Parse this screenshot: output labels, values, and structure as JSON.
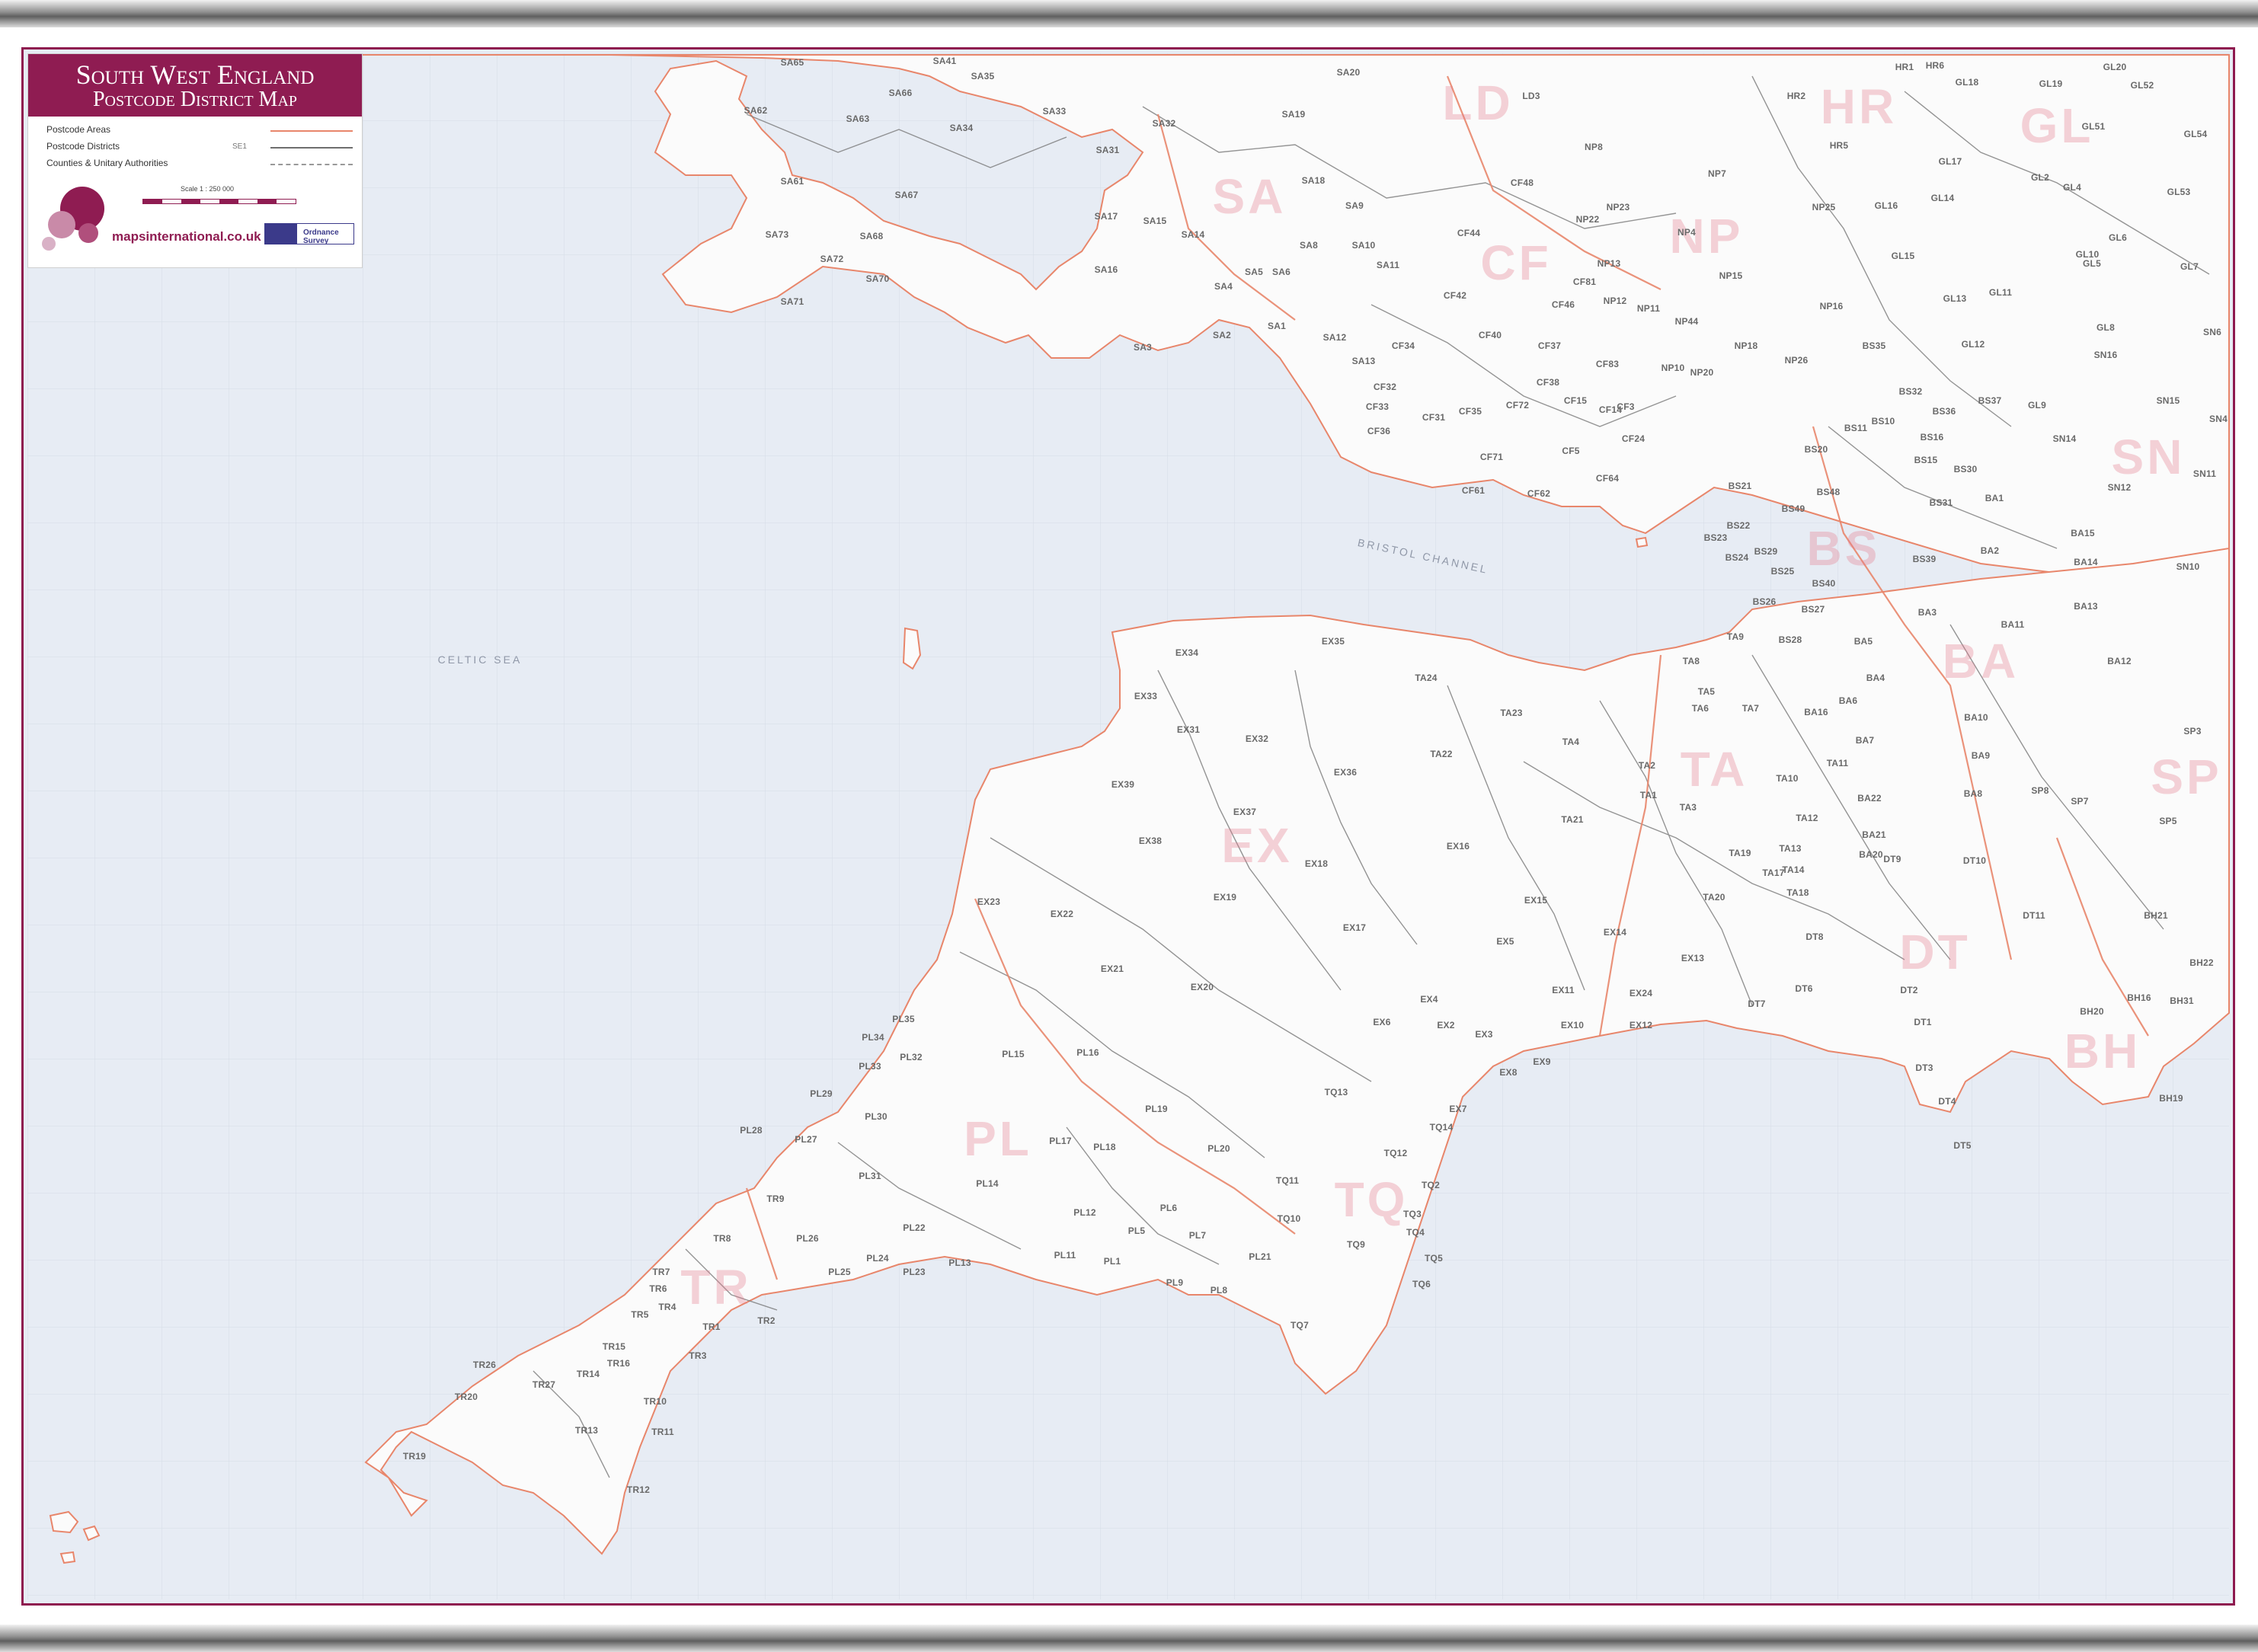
{
  "legend": {
    "title_line1": "South West England",
    "title_line2": "Postcode District Map",
    "items": [
      {
        "label": "Postcode Areas"
      },
      {
        "label": "Postcode Districts",
        "sample": "SE1"
      },
      {
        "label": "Counties & Unitary Authorities"
      }
    ],
    "scale": "Scale 1 : 250 000",
    "brand": "mapsinternational.co.uk",
    "os_badge": "Ordnance Survey"
  },
  "colors": {
    "frame": "#8f1c52",
    "sea": "#e7ecf4",
    "land": "#fbfbfb",
    "district_border": "#6e6e6e",
    "area_border": "#e8866b",
    "area_label": "#e4788c"
  },
  "sea_labels": [
    "CELTIC SEA",
    "BRISTOL CHANNEL"
  ],
  "area_labels": [
    "LD",
    "HR",
    "GL",
    "SA",
    "CF",
    "NP",
    "BS",
    "BA",
    "SN",
    "TA",
    "EX",
    "DT",
    "PL",
    "TQ",
    "TR",
    "BH",
    "SP"
  ],
  "districts": [
    "SA65",
    "SA41",
    "SA35",
    "SA20",
    "LD3",
    "HR1",
    "HR6",
    "GL20",
    "SA62",
    "SA66",
    "SA63",
    "SA33",
    "SA32",
    "SA19",
    "HR2",
    "GL18",
    "GL19",
    "GL52",
    "SA34",
    "NP8",
    "HR5",
    "GL51",
    "GL54",
    "SA31",
    "NP7",
    "GL17",
    "GL2",
    "GL4",
    "SA61",
    "SA67",
    "SA17",
    "SA15",
    "SA18",
    "CF48",
    "SA9",
    "NP22",
    "NP23",
    "NP25",
    "GL16",
    "GL14",
    "GL53",
    "SA14",
    "SA10",
    "CF44",
    "NP4",
    "GL6",
    "SA73",
    "SA68",
    "SA8",
    "SA11",
    "NP13",
    "SA72",
    "SA70",
    "SA16",
    "SA5",
    "SA6",
    "SA4",
    "CF81",
    "NP12",
    "NP15",
    "GL15",
    "GL10",
    "GL5",
    "GL7",
    "SA71",
    "SA2",
    "SA1",
    "SA12",
    "CF42",
    "CF46",
    "NP11",
    "NP44",
    "NP16",
    "GL13",
    "GL11",
    "SA3",
    "SA13",
    "CF34",
    "CF40",
    "CF37",
    "NP18",
    "GL8",
    "CF83",
    "NP10",
    "NP20",
    "NP26",
    "BS35",
    "GL12",
    "SN16",
    "SN6",
    "CF32",
    "CF38",
    "CF72",
    "CF15",
    "CF3",
    "BS32",
    "BS37",
    "GL9",
    "SN15",
    "SN4",
    "CF33",
    "CF31",
    "CF35",
    "CF14",
    "CF24",
    "BS10",
    "BS36",
    "SN14",
    "SN11",
    "CF36",
    "CF5",
    "BS11",
    "BS16",
    "CF71",
    "CF64",
    "BS20",
    "BS15",
    "BS30",
    "CF61",
    "CF62",
    "BS21",
    "BS48",
    "BS31",
    "BA1",
    "SN12",
    "BS22",
    "BS49",
    "BA2",
    "BA15",
    "BS24",
    "BS29",
    "BS39",
    "BA14",
    "BS23",
    "BS25",
    "BS40",
    "SN10",
    "BS26",
    "BS27",
    "BA3",
    "BA11",
    "BA13",
    "TA9",
    "BS28",
    "BA5",
    "BA12",
    "EX35",
    "EX34",
    "TA24",
    "TA8",
    "BA4",
    "EX33",
    "TA23",
    "TA6",
    "TA7",
    "BA16",
    "BA6",
    "EX31",
    "EX32",
    "TA22",
    "TA4",
    "BA10",
    "SP3",
    "BA7",
    "BA9",
    "TA2",
    "TA5",
    "EX39",
    "EX36",
    "TA1",
    "TA3",
    "TA10",
    "TA11",
    "BA22",
    "BA8",
    "SP8",
    "SP7",
    "SP5",
    "EX37",
    "TA21",
    "TA12",
    "BA21",
    "BA20",
    "EX38",
    "EX16",
    "TA19",
    "TA13",
    "TA14",
    "DT9",
    "DT10",
    "EX18",
    "TA17",
    "TA18",
    "TA20",
    "EX23",
    "EX19",
    "EX15",
    "DT11",
    "EX22",
    "EX17",
    "EX14",
    "DT8",
    "BH21",
    "EX21",
    "EX5",
    "EX13",
    "DT2",
    "BH22",
    "EX20",
    "EX11",
    "EX24",
    "DT6",
    "DT7",
    "BH16",
    "BH31",
    "EX4",
    "EX2",
    "DT1",
    "BH20",
    "EX6",
    "EX10",
    "EX12",
    "EX3",
    "PL35",
    "PL34",
    "PL15",
    "PL16",
    "EX8",
    "EX9",
    "PL32",
    "PL33",
    "DT3",
    "BH19",
    "PL29",
    "TQ13",
    "EX7",
    "PL30",
    "PL19",
    "TQ14",
    "DT4",
    "PL28",
    "PL27",
    "PL17",
    "PL18",
    "PL20",
    "TQ12",
    "DT5",
    "PL31",
    "PL14",
    "TQ11",
    "TQ2",
    "TR9",
    "PL12",
    "PL6",
    "TQ3",
    "TQ10",
    "PL22",
    "PL5",
    "PL7",
    "TQ4",
    "TR8",
    "PL26",
    "PL23",
    "PL13",
    "PL11",
    "PL21",
    "TQ9",
    "TQ5",
    "PL25",
    "PL24",
    "PL1",
    "PL9",
    "PL8",
    "TQ6",
    "TR7",
    "TR6",
    "TR4",
    "TR2",
    "TQ7",
    "TR1",
    "TR5",
    "TR15",
    "TR26",
    "TR16",
    "TR3",
    "TR27",
    "TR14",
    "TR20",
    "TR10",
    "TR13",
    "TR11",
    "TR19",
    "TR12"
  ]
}
